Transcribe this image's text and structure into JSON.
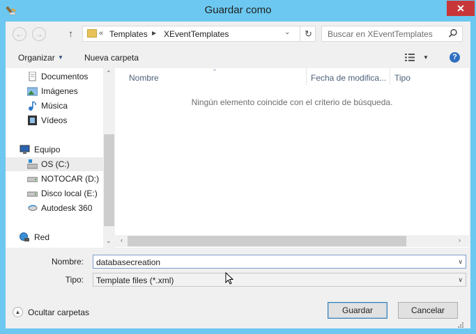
{
  "window": {
    "title": "Guardar como",
    "close_label": "✕"
  },
  "address": {
    "overflow": "«",
    "crumbs": [
      "Templates",
      "XEventTemplates"
    ]
  },
  "search": {
    "placeholder": "Buscar en XEventTemplates"
  },
  "toolbar": {
    "organize_label": "Organizar",
    "new_folder_label": "Nueva carpeta",
    "help_label": "?"
  },
  "nav": {
    "items": [
      {
        "label": "Documentos",
        "icon": "documents-icon"
      },
      {
        "label": "Imágenes",
        "icon": "pictures-icon"
      },
      {
        "label": "Música",
        "icon": "music-icon"
      },
      {
        "label": "Vídeos",
        "icon": "videos-icon"
      },
      {
        "label": "Equipo",
        "icon": "computer-icon"
      },
      {
        "label": "OS (C:)",
        "icon": "system-drive-icon",
        "selected": true
      },
      {
        "label": "NOTOCAR (D:)",
        "icon": "drive-icon"
      },
      {
        "label": "Disco local (E:)",
        "icon": "drive-icon"
      },
      {
        "label": "Autodesk 360",
        "icon": "cloud-drive-icon"
      },
      {
        "label": "Red",
        "icon": "network-icon"
      }
    ]
  },
  "list": {
    "columns": [
      "Nombre",
      "Fecha de modifica...",
      "Tipo"
    ],
    "empty_message": "Ningún elemento coincide con el criterio de búsqueda."
  },
  "form": {
    "name_label": "Nombre:",
    "name_value": "databasecreation",
    "type_label": "Tipo:",
    "type_value": "Template files (*.xml)"
  },
  "footer": {
    "hide_folders_label": "Ocultar carpetas",
    "save_label": "Guardar",
    "cancel_label": "Cancelar"
  },
  "colors": {
    "title_bar": "#6cc8f0",
    "close_button": "#c7373a",
    "accent": "#2f6fc0"
  }
}
